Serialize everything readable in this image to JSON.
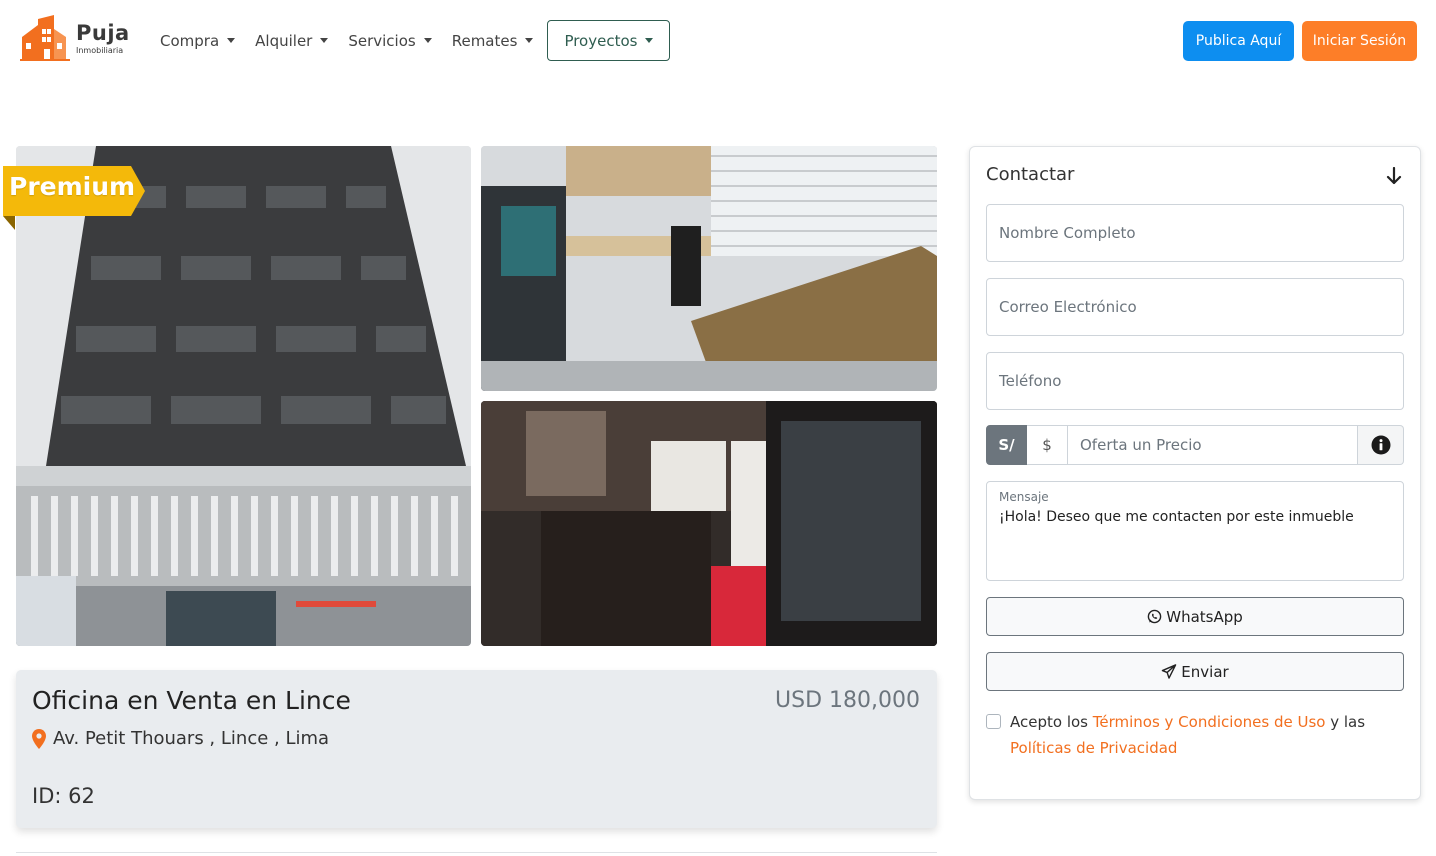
{
  "brand": {
    "name": "Puja",
    "subtitle": "Inmobiliaria",
    "color_primary": "#f26f1f"
  },
  "nav": {
    "items": [
      {
        "label": "Compra"
      },
      {
        "label": "Alquiler"
      },
      {
        "label": "Servicios"
      },
      {
        "label": "Remates"
      },
      {
        "label": "Proyectos"
      }
    ],
    "publish_label": "Publica Aquí",
    "login_label": "Iniciar Sesión",
    "publish_color": "#0d8ef0",
    "login_color": "#fd7e28"
  },
  "gallery": {
    "badge": "Premium",
    "badge_color": "#f4b90a"
  },
  "property": {
    "title": "Oficina en Venta en Lince",
    "price": "USD 180,000",
    "address": "Av. Petit Thouars , Lince , Lima",
    "id_text": "ID: 62",
    "pin_icon": "map-marker-icon"
  },
  "contact": {
    "title": "Contactar",
    "name_placeholder": "Nombre Completo",
    "email_placeholder": "Correo Electrónico",
    "phone_placeholder": "Teléfono",
    "currency_sol": "S/",
    "currency_usd": "$",
    "offer_placeholder": "Oferta un Precio",
    "message_label": "Mensaje",
    "message_value": "¡Hola! Deseo que me contacten por este inmueble",
    "whatsapp_label": "WhatsApp",
    "send_label": "Enviar",
    "terms_prefix": "Acepto los ",
    "terms_link": "Términos y Condiciones de Uso",
    "terms_middle": " y las ",
    "privacy_link": "Políticas de Privacidad"
  }
}
